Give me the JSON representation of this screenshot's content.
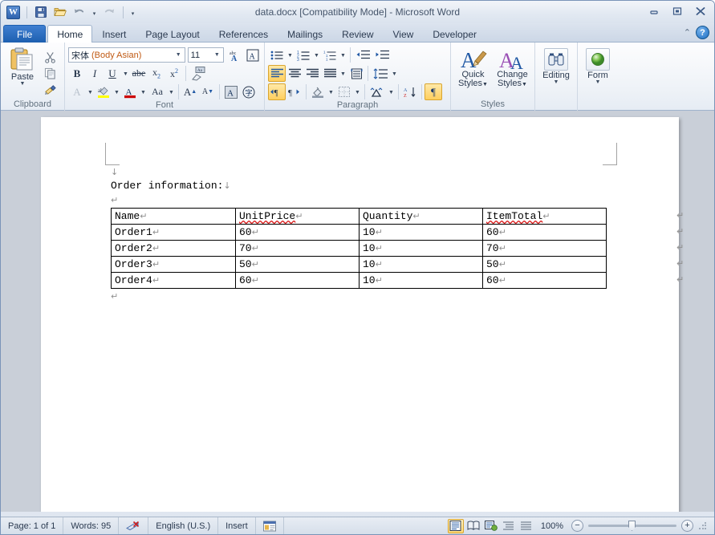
{
  "window": {
    "title": "data.docx [Compatibility Mode]  -  Microsoft Word",
    "minimize": "—",
    "maximize": "❐",
    "close": "✕",
    "app_icon": "W"
  },
  "quick_access": {
    "items": [
      {
        "name": "save-icon",
        "label": "Save"
      },
      {
        "name": "open-icon",
        "label": "Open"
      },
      {
        "name": "undo-icon",
        "label": "Undo"
      },
      {
        "name": "undo-dropdown-icon",
        "label": "▾"
      },
      {
        "name": "redo-icon",
        "label": "Redo"
      },
      {
        "name": "customize-qat-icon",
        "label": "▾"
      }
    ]
  },
  "ribbon": {
    "tabs": [
      {
        "label": "File",
        "active": false,
        "file": true
      },
      {
        "label": "Home",
        "active": true,
        "file": false
      },
      {
        "label": "Insert",
        "active": false,
        "file": false
      },
      {
        "label": "Page Layout",
        "active": false,
        "file": false
      },
      {
        "label": "References",
        "active": false,
        "file": false
      },
      {
        "label": "Mailings",
        "active": false,
        "file": false
      },
      {
        "label": "Review",
        "active": false,
        "file": false
      },
      {
        "label": "View",
        "active": false,
        "file": false
      },
      {
        "label": "Developer",
        "active": false,
        "file": false
      }
    ],
    "collapse_chevron": "⌃",
    "help_label": "?",
    "groups": {
      "clipboard": {
        "label": "Clipboard",
        "paste_label": "Paste",
        "paste_caret": "▼",
        "cut_label": "Cut",
        "copy_label": "Copy",
        "format_painter_label": "Format Painter",
        "dialog_launcher": "◪"
      },
      "font": {
        "label": "Font",
        "font_name": "宋体",
        "font_name_suffix": "(Body Asian)",
        "font_size": "11",
        "caret": "▼",
        "dialog_launcher": "◪",
        "buttons": [
          "grow-font",
          "shrink-font",
          "bold",
          "italic",
          "underline",
          "strikethrough",
          "subscript",
          "superscript",
          "clear-formatting",
          "text-highlight-color",
          "font-color",
          "change-case",
          "text-effects",
          "phonetic-guide",
          "character-border"
        ]
      },
      "paragraph": {
        "label": "Paragraph",
        "dialog_launcher": "◪",
        "buttons": [
          "bullets",
          "numbering",
          "multilevel-list",
          "decrease-indent",
          "increase-indent",
          "align-left",
          "align-center",
          "align-right",
          "justify",
          "distributed",
          "line-spacing",
          "ltr-text-direction",
          "rtl-text-direction",
          "shading",
          "borders",
          "asian-layout",
          "sort",
          "show-formatting-marks"
        ]
      },
      "styles": {
        "label": "Styles",
        "quick_styles_line1": "Quick",
        "quick_styles_line2": "Styles",
        "change_styles_line1": "Change",
        "change_styles_line2": "Styles",
        "caret": "▼",
        "dialog_launcher": "◪"
      },
      "editing": {
        "label": "Editing",
        "caret": "▼"
      },
      "form": {
        "label": "Form",
        "caret": "▼"
      }
    }
  },
  "document": {
    "heading": "Order information:",
    "line_break_mark": "↓",
    "paragraph_mark": "↵",
    "pre_heading_mark": "↓",
    "blank_line_mark": "↵",
    "trailing_mark": "↵",
    "table": {
      "headers": [
        "Name",
        "UnitPrice",
        "Quantity",
        "ItemTotal"
      ],
      "header_misspelled": [
        false,
        true,
        false,
        true
      ],
      "rows": [
        [
          "Order1",
          "60",
          "10",
          "60"
        ],
        [
          "Order2",
          "70",
          "10",
          "70"
        ],
        [
          "Order3",
          "50",
          "10",
          "50"
        ],
        [
          "Order4",
          "60",
          "10",
          "60"
        ]
      ]
    }
  },
  "status_bar": {
    "page": "Page: 1 of 1",
    "words": "Words: 95",
    "proofing_icon": "proofing-errors-icon",
    "language": "English (U.S.)",
    "insert_mode": "Insert",
    "macro_icon": "record-macro-icon",
    "views": [
      {
        "name": "print-layout",
        "active": true
      },
      {
        "name": "full-screen-reading",
        "active": false
      },
      {
        "name": "web-layout",
        "active": false
      },
      {
        "name": "outline",
        "active": false
      },
      {
        "name": "draft",
        "active": false
      }
    ],
    "zoom_level": "100%",
    "zoom_out": "−",
    "zoom_in": "+"
  },
  "colors": {
    "accent_blue": "#1d5fb0",
    "ribbon_bg": "#eef2f7",
    "workspace_bg": "#c9cfd8",
    "page_bg": "#ffffff",
    "misspell_red": "#d81212",
    "highlight_gold": "#ffcf5e"
  }
}
